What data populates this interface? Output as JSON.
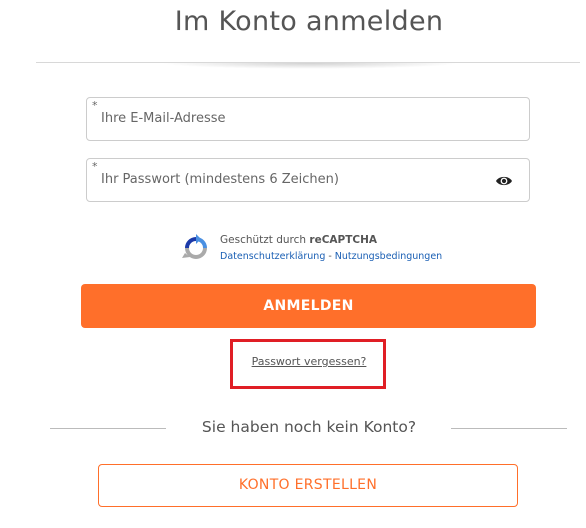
{
  "title": "Im Konto anmelden",
  "email_field": {
    "required_marker": "*",
    "placeholder": "Ihre E-Mail-Adresse",
    "value": ""
  },
  "password_field": {
    "required_marker": "*",
    "placeholder": "Ihr Passwort (mindestens 6 Zeichen)",
    "value": "",
    "toggle_icon": "eye-icon"
  },
  "recaptcha": {
    "protected_prefix": "Geschützt durch",
    "brand": "reCAPTCHA",
    "privacy_link": "Datenschutzerklärung",
    "separator": "-",
    "terms_link": "Nutzungsbedingungen",
    "logo_icon": "recaptcha-logo-icon"
  },
  "login_button": "ANMELDEN",
  "forgot_password": "Passwort vergessen?",
  "no_account_text": "Sie haben noch kein Konto?",
  "create_account_button": "KONTO ERSTELLEN",
  "colors": {
    "accent": "#ff6f2a",
    "highlight_box": "#e01e25",
    "link_blue": "#1a5fb4",
    "text": "#555555"
  }
}
